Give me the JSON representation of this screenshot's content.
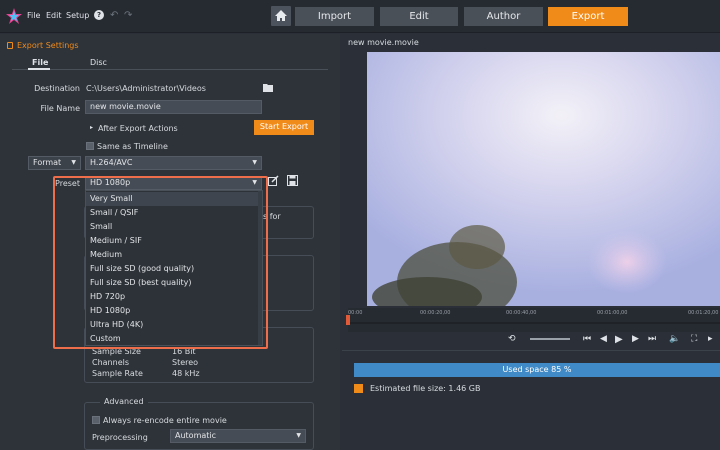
{
  "menu": {
    "file": "File",
    "edit": "Edit",
    "setup": "Setup",
    "help": "?"
  },
  "tabs": [
    {
      "label": "Import",
      "active": false
    },
    {
      "label": "Edit",
      "active": false
    },
    {
      "label": "Author",
      "active": false
    },
    {
      "label": "Export",
      "active": true
    }
  ],
  "export_settings": {
    "title": "Export Settings",
    "subtabs": [
      "File",
      "Disc"
    ],
    "destination_label": "Destination",
    "destination_value": "C:\\Users\\Administrator\\Videos",
    "filename_label": "File Name",
    "filename_value": "new movie.movie",
    "after_export": "After Export Actions",
    "start_export": "Start Export",
    "same_as_timeline": "Same as Timeline",
    "format_label": "Format",
    "format_value": "H.264/AVC",
    "preset_label": "Preset",
    "preset_value": "HD 1080p",
    "preset_options": [
      "Very Small",
      "Small / QSIF",
      "Small",
      "Medium / SIF",
      "Medium",
      "Full size SD (good quality)",
      "Full size SD (best quality)",
      "HD 720p",
      "HD 1080p",
      "Ultra HD (4K)",
      "Custom"
    ],
    "partial_text": "s for",
    "audio": {
      "sample_size_label": "Sample Size",
      "sample_size_value": "16 Bit",
      "channels_label": "Channels",
      "channels_value": "Stereo",
      "sample_rate_label": "Sample Rate",
      "sample_rate_value": "48 kHz"
    },
    "advanced": {
      "title": "Advanced",
      "reencode": "Always re-encode entire movie",
      "preprocessing_label": "Preprocessing",
      "preprocessing_value": "Automatic"
    }
  },
  "preview": {
    "title": "new movie.movie",
    "ticks": [
      "00:00",
      "00:00:20,00",
      "00:00:40,00",
      "00:01:00,00",
      "00:01:20,00"
    ],
    "used_space_text": "Used space 85 %",
    "used_space_fraction": 0.85,
    "estimated_size": "Estimated file size: 1.46 GB"
  },
  "colors": {
    "accent": "#f08a19",
    "usage_bar": "#3f8ac7",
    "highlight": "#ee6d4b"
  }
}
